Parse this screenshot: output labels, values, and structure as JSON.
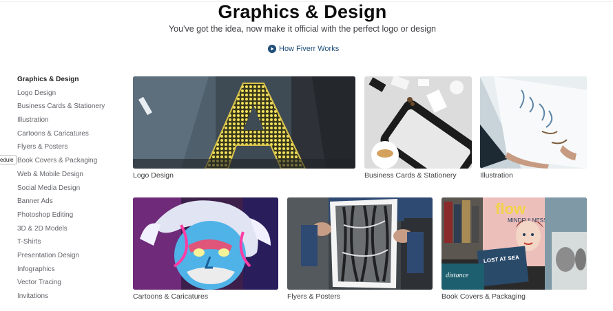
{
  "header": {
    "title": "Graphics & Design",
    "subtitle": "You've got the idea, now make it official with the perfect logo or design",
    "how_link": "How Fiverr Works"
  },
  "tooltip_text": "edule",
  "sidebar": {
    "items": [
      {
        "label": "Graphics & Design",
        "active": true
      },
      {
        "label": "Logo Design"
      },
      {
        "label": "Business Cards & Stationery"
      },
      {
        "label": "Illustration"
      },
      {
        "label": "Cartoons & Caricatures"
      },
      {
        "label": "Flyers & Posters"
      },
      {
        "label": "Book Covers & Packaging"
      },
      {
        "label": "Web & Mobile Design"
      },
      {
        "label": "Social Media Design"
      },
      {
        "label": "Banner Ads"
      },
      {
        "label": "Photoshop Editing"
      },
      {
        "label": "3D & 2D Models"
      },
      {
        "label": "T-Shirts"
      },
      {
        "label": "Presentation Design"
      },
      {
        "label": "Infographics"
      },
      {
        "label": "Vector Tracing"
      },
      {
        "label": "Invitations"
      }
    ]
  },
  "tiles": [
    {
      "label": "Logo Design",
      "image": "letter-a-sign-photo"
    },
    {
      "label": "Business Cards & Stationery",
      "image": "stationery-flatlay-photo"
    },
    {
      "label": "Illustration",
      "image": "sketchbook-photo"
    },
    {
      "label": "Cartoons & Caricatures",
      "image": "einstein-graffiti-photo"
    },
    {
      "label": "Flyers & Posters",
      "image": "hands-holding-poster-photo"
    },
    {
      "label": "Book Covers & Packaging",
      "image": "magazines-photo",
      "cover_text": "flow",
      "cover_subtext": "MINDFULNESS",
      "book_text_1": "LOST AT SEA",
      "book_text_2": "distance"
    }
  ],
  "colors": {
    "title": "#0d0d0d",
    "link": "#1f4e79",
    "sidebar_text": "#62646a"
  }
}
